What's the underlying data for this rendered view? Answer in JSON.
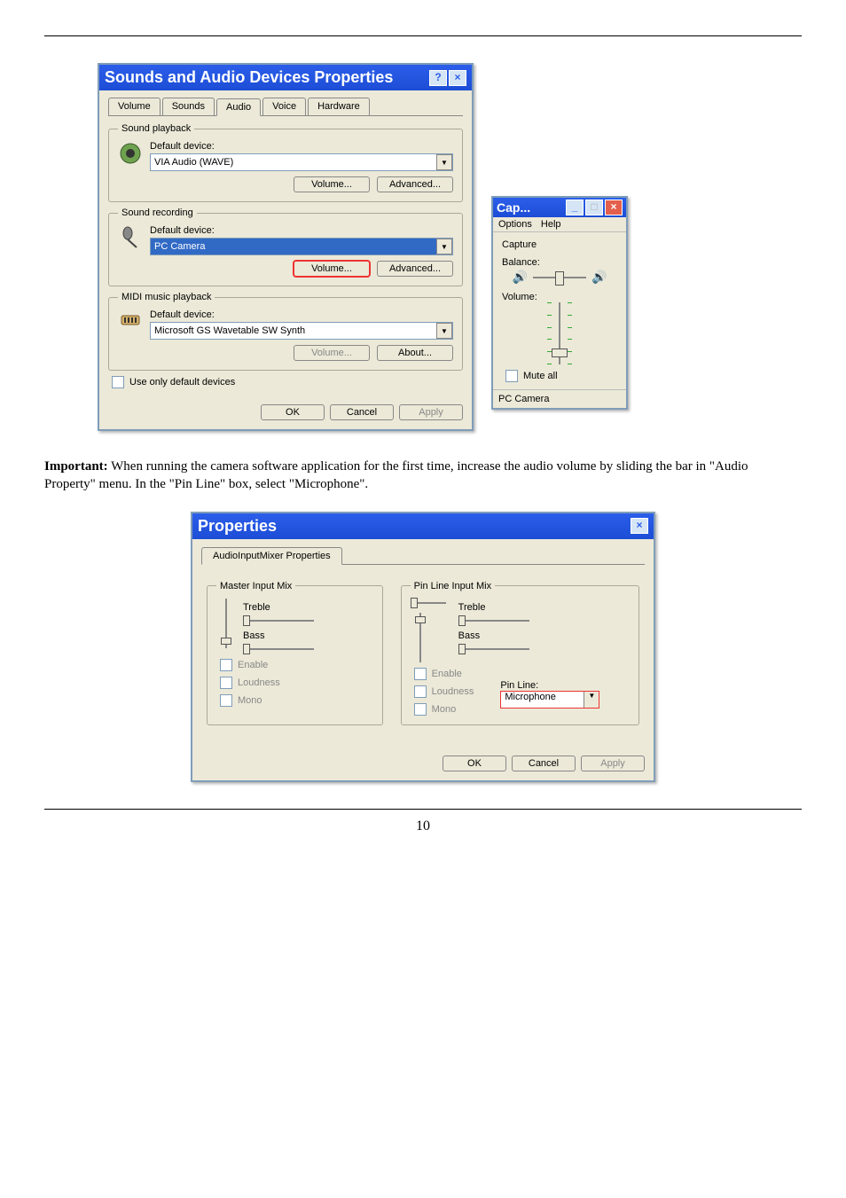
{
  "page_number": "10",
  "important_text_label": "Important:",
  "important_text_body": " When running the camera software application for the first time, increase the audio volume by sliding the bar in \"Audio Property\" menu. In the \"Pin Line\" box, select \"Microphone\".",
  "sound_dialog": {
    "title": "Sounds and Audio Devices Properties",
    "help_btn": "?",
    "close_btn": "×",
    "tabs": {
      "volume": "Volume",
      "sounds": "Sounds",
      "audio": "Audio",
      "voice": "Voice",
      "hardware": "Hardware"
    },
    "playback": {
      "legend": "Sound playback",
      "label": "Default device:",
      "device": "VIA Audio (WAVE)",
      "volume_btn": "Volume...",
      "advanced_btn": "Advanced..."
    },
    "recording": {
      "legend": "Sound recording",
      "label": "Default device:",
      "device": "PC Camera",
      "volume_btn": "Volume...",
      "advanced_btn": "Advanced..."
    },
    "midi": {
      "legend": "MIDI music playback",
      "label": "Default device:",
      "device": "Microsoft GS Wavetable SW Synth",
      "volume_btn": "Volume...",
      "about_btn": "About..."
    },
    "use_only_default": "Use only default devices",
    "ok": "OK",
    "cancel": "Cancel",
    "apply": "Apply"
  },
  "capture_window": {
    "title": "Cap...",
    "min": "_",
    "max": "□",
    "close": "×",
    "menu_options": "Options",
    "menu_help": "Help",
    "capture_label": "Capture",
    "balance_label": "Balance:",
    "volume_label": "Volume:",
    "mute_all": "Mute all",
    "status": "PC Camera"
  },
  "properties_dialog": {
    "title": "Properties",
    "close": "×",
    "tab": "AudioInputMixer Properties",
    "master": {
      "legend": "Master Input Mix",
      "treble": "Treble",
      "bass": "Bass",
      "enable": "Enable",
      "loudness": "Loudness",
      "mono": "Mono"
    },
    "pinline": {
      "legend": "Pin Line Input Mix",
      "treble": "Treble",
      "bass": "Bass",
      "enable": "Enable",
      "loudness": "Loudness",
      "mono": "Mono",
      "pinline_label": "Pin Line:",
      "pinline_value": "Microphone"
    },
    "ok": "OK",
    "cancel": "Cancel",
    "apply": "Apply"
  }
}
